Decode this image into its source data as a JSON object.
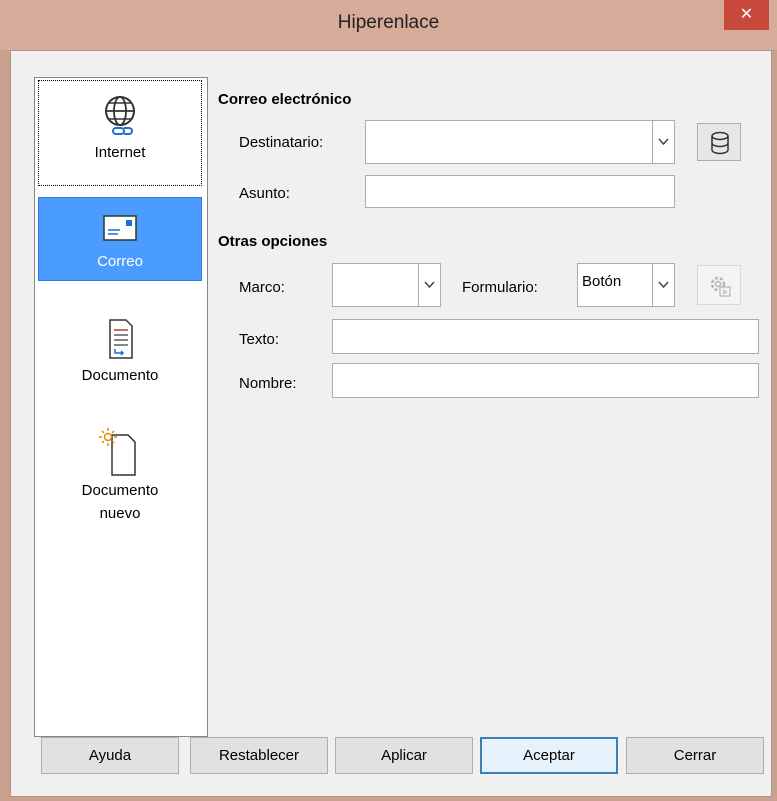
{
  "window": {
    "title": "Hiperenlace",
    "close_glyph": "✕"
  },
  "sidebar": {
    "items": [
      {
        "label": "Internet",
        "icon": "globe-icon",
        "selected": false
      },
      {
        "label": "Correo",
        "icon": "envelope-icon",
        "selected": true
      },
      {
        "label": "Documento",
        "icon": "document-icon",
        "selected": false
      },
      {
        "label": "Documento",
        "label2": "nuevo",
        "icon": "new-document-icon",
        "selected": false
      }
    ]
  },
  "mail": {
    "section_title": "Correo electrónico",
    "recipient_label": "Destinatario:",
    "recipient_value": "",
    "subject_label": "Asunto:",
    "subject_value": ""
  },
  "options": {
    "section_title": "Otras opciones",
    "frame_label": "Marco:",
    "frame_value": "",
    "form_label": "Formulario:",
    "form_value": "Botón",
    "text_label": "Texto:",
    "text_value": "",
    "name_label": "Nombre:",
    "name_value": ""
  },
  "buttons": {
    "help": "Ayuda",
    "reset": "Restablecer",
    "apply": "Aplicar",
    "ok": "Aceptar",
    "close": "Cerrar"
  },
  "colors": {
    "titlebar": "#d7ab99",
    "close": "#c7493b",
    "selection": "#4a9cff",
    "dialog_bg": "#f0f0f0"
  }
}
